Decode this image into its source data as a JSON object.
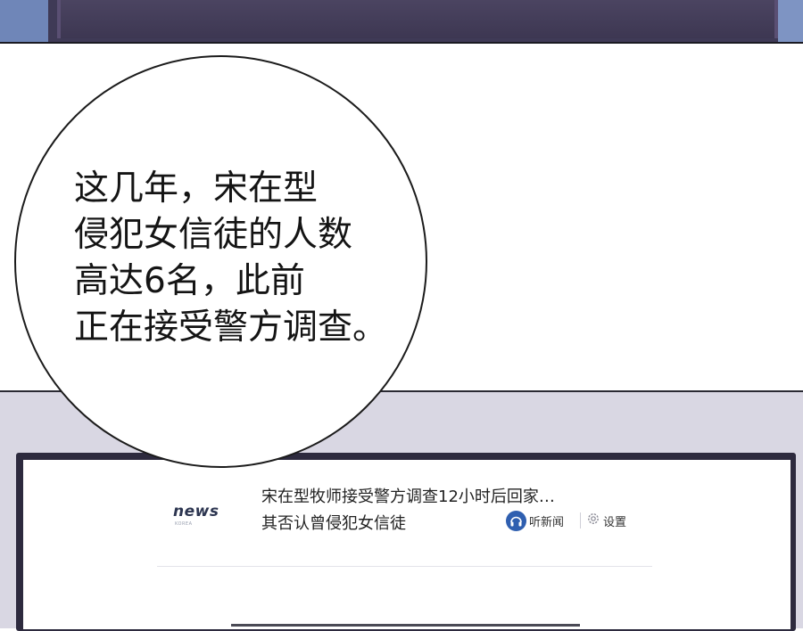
{
  "bubble": {
    "lines": [
      "这几年，宋在型",
      "侵犯女信徒的人数",
      "高达6名，此前",
      "正在接受警方调查。"
    ]
  },
  "news_card": {
    "logo": "news",
    "logo_sub": "KOREA",
    "headline_lines": [
      "宋在型牧师接受警方调查12小时后回家…",
      "其否认曾侵犯女信徒"
    ],
    "listen_label": "听新闻",
    "settings_label": "设置"
  },
  "colors": {
    "top_panel": "#3f3a56",
    "lower_panel": "#d9d7e3",
    "screen_frame": "#2d2a3e",
    "listen_icon": "#2f5fb0"
  }
}
